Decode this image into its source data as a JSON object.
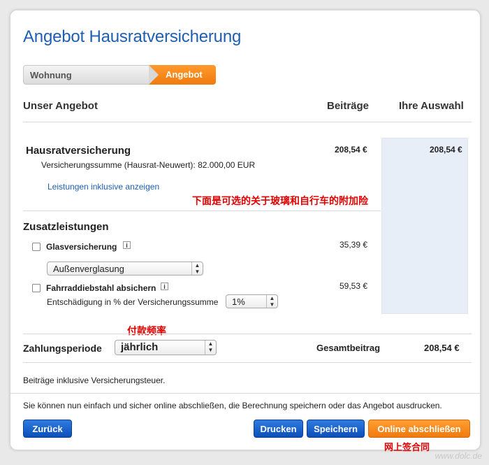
{
  "title": "Angebot Hausratversicherung",
  "steps": [
    "Wohnung",
    "Angebot"
  ],
  "columns": {
    "offer": "Unser Angebot",
    "premium": "Beiträge",
    "choice": "Ihre Auswahl"
  },
  "main_insurance": {
    "name": "Hausratversicherung",
    "sum_insured": "Versicherungssumme (Hausrat-Neuwert): 82.000,00 EUR",
    "premium": "208,54 €",
    "choice": "208,54 €",
    "details_link": "Leistungen inklusive anzeigen"
  },
  "annotation_addons": "下面是可选的关于玻璃和自行车的附加险",
  "addons": {
    "heading": "Zusatzleistungen",
    "glass": {
      "label": "Glasversicherung",
      "price": "35,39 €",
      "select_value": "Außenverglasung"
    },
    "bike": {
      "label": "Fahrraddiebstahl absichern",
      "price": "59,53 €",
      "compensation_label": "Entschädigung in % der Versicherungssumme",
      "compensation_value": "1%"
    }
  },
  "annotation_payment": "付款频率",
  "payment": {
    "label": "Zahlungsperiode",
    "value": "jährlich",
    "total_label": "Gesamtbeitrag",
    "total_value": "208,54 €"
  },
  "tax_note": "Beiträge inklusive Versicherungsteuer.",
  "info_text": "Sie können nun einfach und sicher online abschließen, die Berechnung speichern oder das Angebot ausdrucken.",
  "buttons": {
    "back": "Zurück",
    "print": "Drucken",
    "save": "Speichern",
    "complete": "Online abschließen"
  },
  "annotation_sign": "网上签合同",
  "watermark": "www.dolc.de",
  "icons": {
    "info": "i"
  },
  "colors": {
    "accent_blue": "#1f5fb3",
    "accent_orange": "#f07a0e",
    "annotation_red": "#e00000"
  }
}
